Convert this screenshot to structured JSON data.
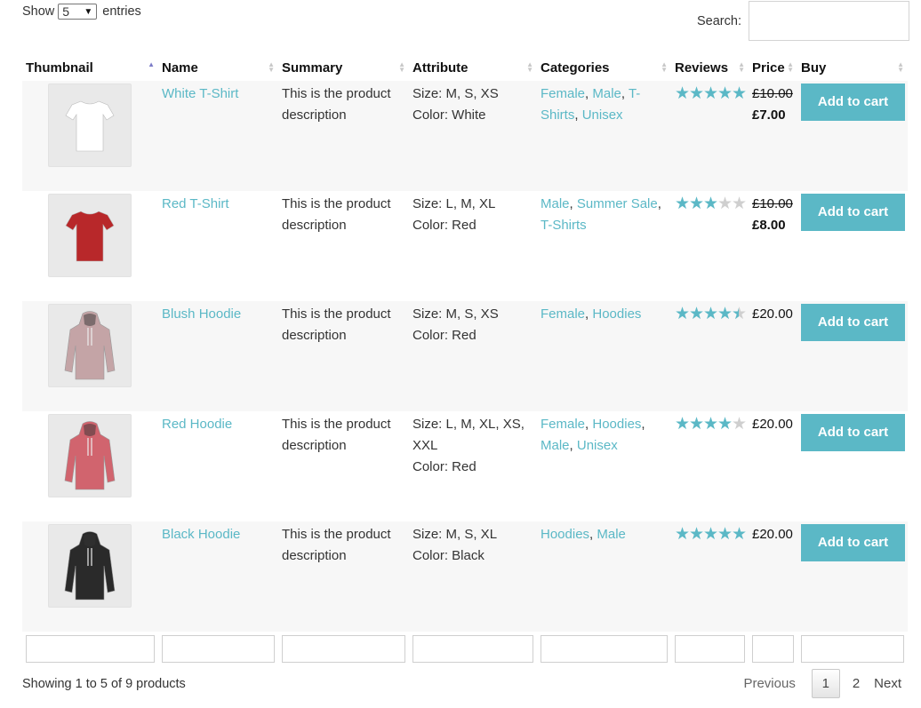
{
  "length": {
    "show": "Show",
    "value": "5",
    "entries": "entries"
  },
  "search": {
    "label": "Search:",
    "value": ""
  },
  "columns": [
    "Thumbnail",
    "Name",
    "Summary",
    "Attribute",
    "Categories",
    "Reviews",
    "Price",
    "Buy"
  ],
  "products": [
    {
      "name": "White T-Shirt",
      "summary": "This is the product description",
      "attr_size": "Size: M, S, XS",
      "attr_color": "Color: White",
      "categories": [
        "Female",
        "Male",
        "T-Shirts",
        "Unisex"
      ],
      "rating": 5,
      "price_old": "£10.00",
      "price_now": "£7.00",
      "button": "Add to cart",
      "thumb_color": "#ffffff"
    },
    {
      "name": "Red T-Shirt",
      "summary": "This is the product description",
      "attr_size": "Size: L, M, XL",
      "attr_color": "Color: Red",
      "categories": [
        "Male",
        "Summer Sale",
        "T-Shirts"
      ],
      "rating": 3,
      "price_old": "£10.00",
      "price_now": "£8.00",
      "button": "Add to cart",
      "thumb_color": "#b8282a"
    },
    {
      "name": "Blush Hoodie",
      "summary": "This is the product description",
      "attr_size": "Size: M, S, XS",
      "attr_color": "Color: Red",
      "categories": [
        "Female",
        "Hoodies"
      ],
      "rating": 4.5,
      "price_old": "",
      "price_now": "£20.00",
      "button": "Add to cart",
      "thumb_color": "#c4a4a6"
    },
    {
      "name": "Red Hoodie",
      "summary": "This is the product description",
      "attr_size": "Size: L, M, XL, XS, XXL",
      "attr_color": "Color: Red",
      "categories": [
        "Female",
        "Hoodies",
        "Male",
        "Unisex"
      ],
      "rating": 4,
      "price_old": "",
      "price_now": "£20.00",
      "button": "Add to cart",
      "thumb_color": "#d1646e"
    },
    {
      "name": "Black Hoodie",
      "summary": "This is the product description",
      "attr_size": "Size: M, S, XL",
      "attr_color": "Color: Black",
      "categories": [
        "Hoodies",
        "Male"
      ],
      "rating": 5,
      "price_old": "",
      "price_now": "£20.00",
      "button": "Add to cart",
      "thumb_color": "#2a2a2a"
    }
  ],
  "info": "Showing 1 to 5 of 9 products",
  "pager": {
    "previous": "Previous",
    "pages": [
      "1",
      "2"
    ],
    "current": "1",
    "next": "Next"
  },
  "colors": {
    "accent": "#5bb8c6",
    "row_alt": "#f7f7f7"
  }
}
